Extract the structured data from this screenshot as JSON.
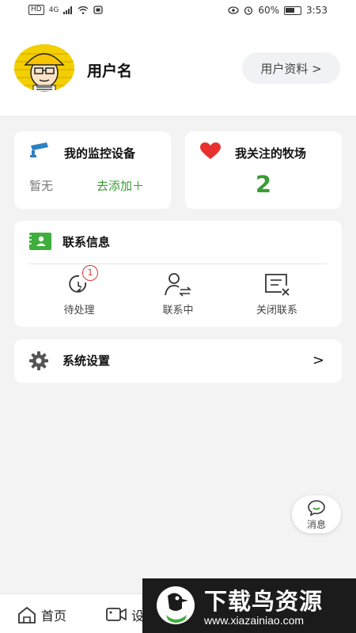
{
  "status_bar": {
    "left_text": "HD",
    "network": "4G",
    "battery_percent": "60%",
    "time": "3:53"
  },
  "profile": {
    "username": "用户名",
    "profile_button_label": "用户资料 >",
    "avatar_icon": "avatar-cartoon-icon"
  },
  "devices_card": {
    "title": "我的监控设备",
    "empty_text": "暂无",
    "add_link": "去添加＋"
  },
  "farms_card": {
    "title": "我关注的牧场",
    "count": "2"
  },
  "contact_card": {
    "title": "联系信息",
    "items": [
      {
        "label": "待处理",
        "badge": "1"
      },
      {
        "label": "联系中"
      },
      {
        "label": "关闭联系"
      }
    ]
  },
  "settings_card": {
    "title": "系统设置",
    "chevron": ">"
  },
  "floating_message": {
    "label": "消息"
  },
  "tabbar": {
    "tabs": [
      {
        "label": "首页"
      },
      {
        "label": "设"
      }
    ]
  },
  "watermark": {
    "title": "下载鸟资源",
    "url": "www.xiazainiao.com"
  },
  "colors": {
    "accent_green": "#3a9b35",
    "badge_red": "#d33333",
    "heart_red": "#e8312f",
    "contact_icon_green": "#3fae3a"
  }
}
